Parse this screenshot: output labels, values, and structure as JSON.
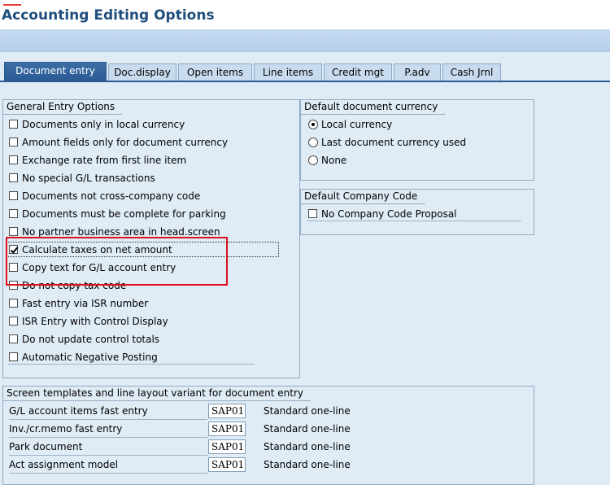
{
  "title": "Accounting Editing Options",
  "tabs": [
    {
      "label": "Document entry",
      "active": true
    },
    {
      "label": "Doc.display",
      "active": false
    },
    {
      "label": "Open items",
      "active": false
    },
    {
      "label": "Line items",
      "active": false
    },
    {
      "label": "Credit mgt",
      "active": false
    },
    {
      "label": "P.adv",
      "active": false
    },
    {
      "label": "Cash Jrnl",
      "active": false
    }
  ],
  "general": {
    "title": "General Entry Options",
    "options": [
      {
        "label": "Documents only in local currency",
        "checked": false
      },
      {
        "label": "Amount fields only for document currency",
        "checked": false
      },
      {
        "label": "Exchange rate from first line item",
        "checked": false
      },
      {
        "label": "No special G/L transactions",
        "checked": false
      },
      {
        "label": "Documents not cross-company code",
        "checked": false
      },
      {
        "label": "Documents must be complete for parking",
        "checked": false
      },
      {
        "label": "No partner business area in head.screen",
        "checked": false
      },
      {
        "label": "Calculate taxes on net amount",
        "checked": true
      },
      {
        "label": "Copy text for G/L account entry",
        "checked": false
      },
      {
        "label": "Do not copy tax code",
        "checked": false
      },
      {
        "label": "Fast entry via ISR number",
        "checked": false
      },
      {
        "label": "ISR Entry with Control Display",
        "checked": false
      },
      {
        "label": "Do not update control totals",
        "checked": false
      },
      {
        "label": "Automatic Negative Posting",
        "checked": false
      }
    ]
  },
  "currency": {
    "title": "Default document currency",
    "options": [
      {
        "label": "Local currency",
        "selected": true
      },
      {
        "label": "Last document currency used",
        "selected": false
      },
      {
        "label": "None",
        "selected": false
      }
    ]
  },
  "company": {
    "title": "Default Company Code",
    "option": {
      "label": "No Company Code Proposal",
      "checked": false
    }
  },
  "templates": {
    "title": "Screen templates and line layout variant for document entry",
    "rows": [
      {
        "label": "G/L account items fast entry",
        "value": "SAP01",
        "desc": "Standard one-line"
      },
      {
        "label": "Inv./cr.memo fast entry",
        "value": "SAP01",
        "desc": "Standard one-line"
      },
      {
        "label": "Park document",
        "value": "SAP01",
        "desc": "Standard one-line"
      },
      {
        "label": "Act assignment model",
        "value": "SAP01",
        "desc": "Standard one-line"
      }
    ]
  },
  "colors": {
    "title_text": "#1f4f7c",
    "active_tab": "#2a5a93",
    "highlight_box": "#e0101a",
    "background": "#dfebf5"
  }
}
